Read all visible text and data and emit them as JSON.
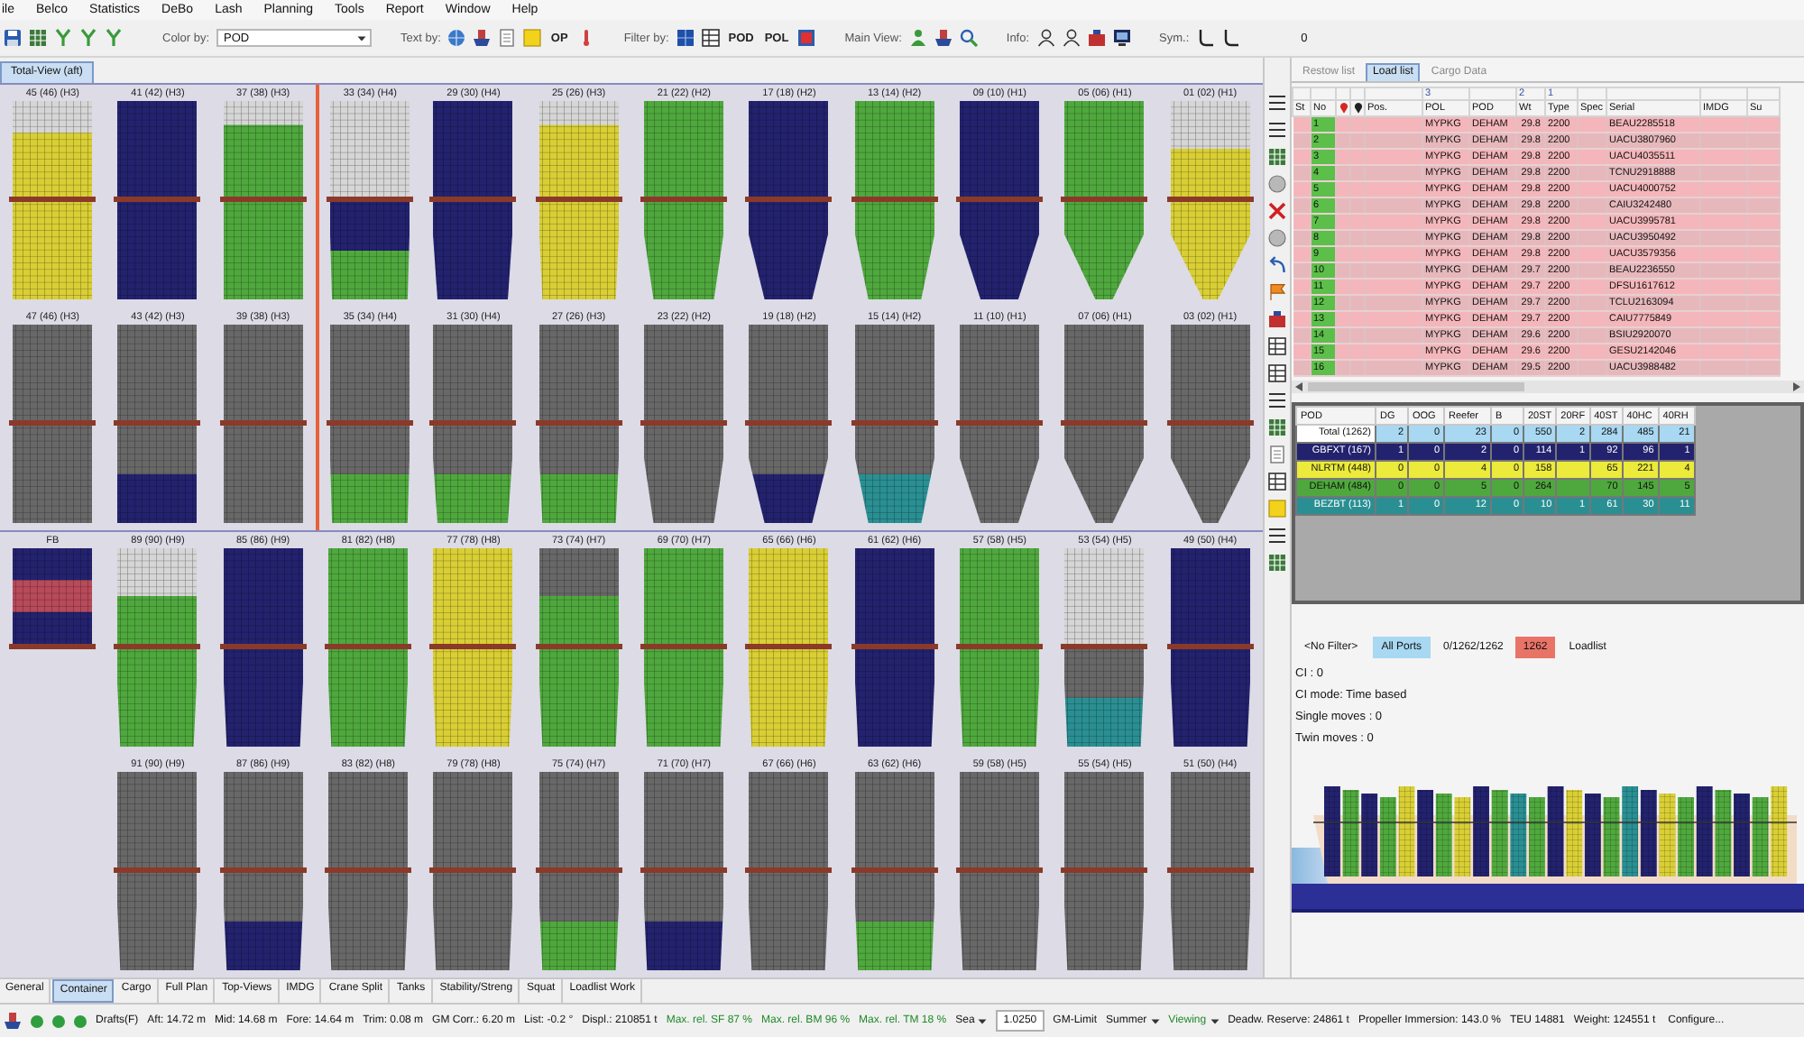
{
  "menu": [
    "ile",
    "Belco",
    "Statistics",
    "DeBo",
    "Lash",
    "Planning",
    "Tools",
    "Report",
    "Window",
    "Help"
  ],
  "toolbar": {
    "color_by": {
      "label": "Color by:",
      "value": "POD"
    },
    "text_by": {
      "label": "Text by:",
      "option": "OP"
    },
    "filter_by": {
      "label": "Filter by:",
      "options": [
        "POD",
        "POL"
      ]
    },
    "main_view": {
      "label": "Main View:"
    },
    "info": {
      "label": "Info:"
    },
    "sym": {
      "label": "Sym.:",
      "value": "0"
    }
  },
  "view_tab": {
    "label": "Total-View (aft)"
  },
  "bay_rows": [
    {
      "bays": [
        {
          "label": "45 (46) (H3)",
          "deck": [
            {
              "color": "#d6d6d6"
            },
            {
              "color": "#d9cf35"
            },
            {
              "color": "#d9cf35"
            }
          ],
          "hold": [
            {
              "color": "#d9cf35"
            }
          ]
        },
        {
          "label": "41 (42) (H3)",
          "deck": [
            {
              "color": "#23226e"
            }
          ],
          "hold": [
            {
              "color": "#23226e"
            }
          ]
        },
        {
          "label": "37 (38) (H3)",
          "deck": [
            {
              "color": "#d6d6d6"
            },
            {
              "color": "#4fa83d"
            },
            {
              "color": "#4fa83d"
            },
            {
              "color": "#4fa83d"
            }
          ],
          "hold": [
            {
              "color": "#4fa83d"
            }
          ]
        },
        {
          "label": "33 (34) (H4)",
          "deck": [
            {
              "color": "#d6d6d6"
            }
          ],
          "hold": [
            {
              "color": "#23226e"
            },
            {
              "color": "#4fa83d"
            }
          ]
        },
        {
          "label": "29 (30) (H4)",
          "deck": [
            {
              "color": "#23226e"
            }
          ],
          "hold": [
            {
              "color": "#23226e"
            }
          ]
        },
        {
          "label": "25 (26) (H3)",
          "deck": [
            {
              "color": "#d6d6d6"
            },
            {
              "color": "#d9cf35"
            },
            {
              "color": "#d9cf35"
            },
            {
              "color": "#d9cf35"
            }
          ],
          "hold": [
            {
              "color": "#d9cf35"
            }
          ]
        },
        {
          "label": "21 (22) (H2)",
          "deck": [
            {
              "color": "#4fa83d"
            }
          ],
          "hold": [
            {
              "color": "#4fa83d"
            }
          ]
        },
        {
          "label": "17 (18) (H2)",
          "deck": [
            {
              "color": "#23226e"
            }
          ],
          "hold": [
            {
              "color": "#23226e"
            }
          ]
        },
        {
          "label": "13 (14) (H2)",
          "deck": [
            {
              "color": "#4fa83d"
            }
          ],
          "hold": [
            {
              "color": "#4fa83d"
            }
          ]
        },
        {
          "label": "09 (10) (H1)",
          "deck": [
            {
              "color": "#23226e"
            }
          ],
          "hold": [
            {
              "color": "#23226e"
            }
          ]
        },
        {
          "label": "05 (06) (H1)",
          "deck": [
            {
              "color": "#4fa83d"
            }
          ],
          "hold": [
            {
              "color": "#4fa83d"
            }
          ]
        },
        {
          "label": "01 (02) (H1)",
          "deck": [
            {
              "color": "#d6d6d6"
            },
            {
              "color": "#d9cf35"
            }
          ],
          "hold": [
            {
              "color": "#d9cf35"
            }
          ]
        }
      ]
    },
    {
      "bays": [
        {
          "label": "47 (46) (H3)",
          "deck": [
            {
              "color": "#686868"
            }
          ],
          "hold": [
            {
              "color": "#686868"
            },
            {
              "color": "#686868"
            }
          ]
        },
        {
          "label": "43 (42) (H3)",
          "deck": [
            {
              "color": "#686868"
            }
          ],
          "hold": [
            {
              "color": "#686868"
            },
            {
              "color": "#23226e"
            }
          ]
        },
        {
          "label": "39 (38) (H3)",
          "deck": [
            {
              "color": "#686868"
            }
          ],
          "hold": [
            {
              "color": "#686868"
            },
            {
              "color": "#686868"
            }
          ]
        },
        {
          "label": "35 (34) (H4)",
          "deck": [
            {
              "color": "#686868"
            }
          ],
          "hold": [
            {
              "color": "#686868"
            },
            {
              "color": "#4fa83d"
            }
          ]
        },
        {
          "label": "31 (30) (H4)",
          "deck": [
            {
              "color": "#686868"
            }
          ],
          "hold": [
            {
              "color": "#686868"
            },
            {
              "color": "#4fa83d"
            }
          ]
        },
        {
          "label": "27 (26) (H3)",
          "deck": [
            {
              "color": "#686868"
            }
          ],
          "hold": [
            {
              "color": "#686868"
            },
            {
              "color": "#4fa83d"
            }
          ]
        },
        {
          "label": "23 (22) (H2)",
          "deck": [
            {
              "color": "#686868"
            }
          ],
          "hold": [
            {
              "color": "#686868"
            },
            {
              "color": "#686868"
            }
          ]
        },
        {
          "label": "19 (18) (H2)",
          "deck": [
            {
              "color": "#686868"
            }
          ],
          "hold": [
            {
              "color": "#686868"
            },
            {
              "color": "#23226e"
            }
          ]
        },
        {
          "label": "15 (14) (H2)",
          "deck": [
            {
              "color": "#686868"
            }
          ],
          "hold": [
            {
              "color": "#686868"
            },
            {
              "color": "#2a8f92"
            }
          ]
        },
        {
          "label": "11 (10) (H1)",
          "deck": [
            {
              "color": "#686868"
            }
          ],
          "hold": [
            {
              "color": "#686868"
            }
          ]
        },
        {
          "label": "07 (06) (H1)",
          "deck": [
            {
              "color": "#686868"
            }
          ],
          "hold": [
            {
              "color": "#686868"
            }
          ]
        },
        {
          "label": "03 (02) (H1)",
          "deck": [
            {
              "color": "#686868"
            }
          ],
          "hold": [
            {
              "color": "#686868"
            }
          ]
        }
      ]
    },
    {
      "bays": [
        {
          "label": "FB",
          "deck": [
            {
              "color": "#23226e"
            },
            {
              "color": "#b84a5a"
            },
            {
              "color": "#23226e"
            }
          ]
        },
        {
          "label": "89 (90) (H9)",
          "deck": [
            {
              "color": "#d6d6d6"
            },
            {
              "color": "#4fa83d"
            }
          ],
          "hold": [
            {
              "color": "#4fa83d"
            }
          ]
        },
        {
          "label": "85 (86) (H9)",
          "deck": [
            {
              "color": "#23226e"
            }
          ],
          "hold": [
            {
              "color": "#23226e"
            }
          ]
        },
        {
          "label": "81 (82) (H8)",
          "deck": [
            {
              "color": "#4fa83d"
            }
          ],
          "hold": [
            {
              "color": "#4fa83d"
            }
          ]
        },
        {
          "label": "77 (78) (H8)",
          "deck": [
            {
              "color": "#d9cf35"
            }
          ],
          "hold": [
            {
              "color": "#d9cf35"
            }
          ]
        },
        {
          "label": "73 (74) (H7)",
          "deck": [
            {
              "color": "#686868"
            },
            {
              "color": "#4fa83d"
            }
          ],
          "hold": [
            {
              "color": "#4fa83d"
            }
          ]
        },
        {
          "label": "69 (70) (H7)",
          "deck": [
            {
              "color": "#4fa83d"
            }
          ],
          "hold": [
            {
              "color": "#4fa83d"
            }
          ]
        },
        {
          "label": "65 (66) (H6)",
          "deck": [
            {
              "color": "#d9cf35"
            }
          ],
          "hold": [
            {
              "color": "#d9cf35"
            }
          ]
        },
        {
          "label": "61 (62) (H6)",
          "deck": [
            {
              "color": "#23226e"
            }
          ],
          "hold": [
            {
              "color": "#23226e"
            }
          ]
        },
        {
          "label": "57 (58) (H5)",
          "deck": [
            {
              "color": "#4fa83d"
            }
          ],
          "hold": [
            {
              "color": "#4fa83d"
            }
          ]
        },
        {
          "label": "53 (54) (H5)",
          "deck": [
            {
              "color": "#d6d6d6"
            }
          ],
          "hold": [
            {
              "color": "#686868"
            },
            {
              "color": "#2a8f92"
            }
          ]
        },
        {
          "label": "49 (50) (H4)",
          "deck": [
            {
              "color": "#23226e"
            }
          ],
          "hold": [
            {
              "color": "#23226e"
            }
          ]
        }
      ]
    },
    {
      "bays": [
        {
          "label": "91 (90) (H9)",
          "deck": [
            {
              "color": "#686868"
            }
          ],
          "hold": [
            {
              "color": "#686868"
            },
            {
              "color": "#686868"
            }
          ]
        },
        {
          "label": "87 (86) (H9)",
          "deck": [
            {
              "color": "#686868"
            }
          ],
          "hold": [
            {
              "color": "#686868"
            },
            {
              "color": "#23226e"
            }
          ]
        },
        {
          "label": "83 (82) (H8)",
          "deck": [
            {
              "color": "#686868"
            }
          ],
          "hold": [
            {
              "color": "#686868"
            },
            {
              "color": "#686868"
            }
          ]
        },
        {
          "label": "79 (78) (H8)",
          "deck": [
            {
              "color": "#686868"
            }
          ],
          "hold": [
            {
              "color": "#686868"
            },
            {
              "color": "#686868"
            }
          ]
        },
        {
          "label": "75 (74) (H7)",
          "deck": [
            {
              "color": "#686868"
            }
          ],
          "hold": [
            {
              "color": "#686868"
            },
            {
              "color": "#4fa83d"
            }
          ]
        },
        {
          "label": "71 (70) (H7)",
          "deck": [
            {
              "color": "#686868"
            }
          ],
          "hold": [
            {
              "color": "#686868"
            },
            {
              "color": "#23226e"
            }
          ]
        },
        {
          "label": "67 (66) (H6)",
          "deck": [
            {
              "color": "#686868"
            }
          ],
          "hold": [
            {
              "color": "#686868"
            },
            {
              "color": "#686868"
            }
          ]
        },
        {
          "label": "63 (62) (H6)",
          "deck": [
            {
              "color": "#686868"
            }
          ],
          "hold": [
            {
              "color": "#686868"
            },
            {
              "color": "#4fa83d"
            }
          ]
        },
        {
          "label": "59 (58) (H5)",
          "deck": [
            {
              "color": "#686868"
            }
          ],
          "hold": [
            {
              "color": "#686868"
            },
            {
              "color": "#686868"
            }
          ]
        },
        {
          "label": "55 (54) (H5)",
          "deck": [
            {
              "color": "#686868"
            }
          ],
          "hold": [
            {
              "color": "#686868"
            },
            {
              "color": "#686868"
            }
          ]
        },
        {
          "label": "51 (50) (H4)",
          "deck": [
            {
              "color": "#686868"
            }
          ],
          "hold": [
            {
              "color": "#686868"
            },
            {
              "color": "#686868"
            }
          ]
        }
      ]
    }
  ],
  "side_panel": {
    "tabs": [
      {
        "label": "Restow list",
        "selected": false
      },
      {
        "label": "Load list",
        "selected": true
      },
      {
        "label": "Cargo Data",
        "selected": false
      }
    ],
    "load_list": {
      "columns": [
        {
          "kind": "text",
          "label": "St"
        },
        {
          "kind": "text",
          "label": "No"
        },
        {
          "kind": "icon",
          "color": "#d02828"
        },
        {
          "kind": "icon",
          "color": "#222222"
        },
        {
          "kind": "text",
          "label": "Pos."
        },
        {
          "kind": "text",
          "label": "POL",
          "sort": "3"
        },
        {
          "kind": "text",
          "label": "POD"
        },
        {
          "kind": "text",
          "label": "Wt",
          "sort": "2"
        },
        {
          "kind": "text",
          "label": "Type",
          "sort": "1"
        },
        {
          "kind": "text",
          "label": "Spec"
        },
        {
          "kind": "text",
          "label": "Serial"
        },
        {
          "kind": "text",
          "label": "IMDG"
        },
        {
          "kind": "text",
          "label": "Su"
        }
      ],
      "rows": [
        {
          "no": "1",
          "pol": "MYPKG",
          "pod": "DEHAM",
          "wt": "29.8",
          "type": "2200",
          "serial": "BEAU2285518"
        },
        {
          "no": "2",
          "pol": "MYPKG",
          "pod": "DEHAM",
          "wt": "29.8",
          "type": "2200",
          "serial": "UACU3807960"
        },
        {
          "no": "3",
          "pol": "MYPKG",
          "pod": "DEHAM",
          "wt": "29.8",
          "type": "2200",
          "serial": "UACU4035511"
        },
        {
          "no": "4",
          "pol": "MYPKG",
          "pod": "DEHAM",
          "wt": "29.8",
          "type": "2200",
          "serial": "TCNU2918888"
        },
        {
          "no": "5",
          "pol": "MYPKG",
          "pod": "DEHAM",
          "wt": "29.8",
          "type": "2200",
          "serial": "UACU4000752"
        },
        {
          "no": "6",
          "pol": "MYPKG",
          "pod": "DEHAM",
          "wt": "29.8",
          "type": "2200",
          "serial": "CAIU3242480"
        },
        {
          "no": "7",
          "pol": "MYPKG",
          "pod": "DEHAM",
          "wt": "29.8",
          "type": "2200",
          "serial": "UACU3995781"
        },
        {
          "no": "8",
          "pol": "MYPKG",
          "pod": "DEHAM",
          "wt": "29.8",
          "type": "2200",
          "serial": "UACU3950492"
        },
        {
          "no": "9",
          "pol": "MYPKG",
          "pod": "DEHAM",
          "wt": "29.8",
          "type": "2200",
          "serial": "UACU3579356"
        },
        {
          "no": "10",
          "pol": "MYPKG",
          "pod": "DEHAM",
          "wt": "29.7",
          "type": "2200",
          "serial": "BEAU2236550"
        },
        {
          "no": "11",
          "pol": "MYPKG",
          "pod": "DEHAM",
          "wt": "29.7",
          "type": "2200",
          "serial": "DFSU1617612"
        },
        {
          "no": "12",
          "pol": "MYPKG",
          "pod": "DEHAM",
          "wt": "29.7",
          "type": "2200",
          "serial": "TCLU2163094"
        },
        {
          "no": "13",
          "pol": "MYPKG",
          "pod": "DEHAM",
          "wt": "29.7",
          "type": "2200",
          "serial": "CAIU7775849"
        },
        {
          "no": "14",
          "pol": "MYPKG",
          "pod": "DEHAM",
          "wt": "29.6",
          "type": "2200",
          "serial": "BSIU2920070"
        },
        {
          "no": "15",
          "pol": "MYPKG",
          "pod": "DEHAM",
          "wt": "29.6",
          "type": "2200",
          "serial": "GESU2142046"
        },
        {
          "no": "16",
          "pol": "MYPKG",
          "pod": "DEHAM",
          "wt": "29.5",
          "type": "2200",
          "serial": "UACU3988482"
        }
      ]
    },
    "summary": {
      "columns": [
        "POD",
        "DG",
        "OOG",
        "Reefer",
        "B",
        "20ST",
        "20RF",
        "40ST",
        "40HC",
        "40RH"
      ],
      "rows": [
        {
          "kind": "total",
          "color": "#a8d8f2",
          "label": "Total (1262)",
          "values": {
            "dg": "2",
            "oog": "0",
            "reefer": "23",
            "b": "0",
            "st20": "550",
            "rf20": "2",
            "st40": "284",
            "hc40": "485",
            "rh40": "21"
          }
        },
        {
          "kind": "port",
          "color": "#23226e",
          "label": "GBFXT (167)",
          "values": {
            "dg": "1",
            "oog": "0",
            "reefer": "2",
            "b": "0",
            "st20": "114",
            "rf20": "1",
            "st40": "92",
            "hc40": "96",
            "rh40": "1"
          }
        },
        {
          "kind": "port",
          "color": "#ecea3a",
          "label": "NLRTM (448)",
          "values": {
            "dg": "0",
            "oog": "0",
            "reefer": "4",
            "b": "0",
            "st20": "158",
            "st40": "65",
            "hc40": "221",
            "rh40": "4"
          }
        },
        {
          "kind": "port",
          "color": "#4fa83d",
          "label": "DEHAM (484)",
          "values": {
            "dg": "0",
            "oog": "0",
            "reefer": "5",
            "b": "0",
            "st20": "264",
            "st40": "70",
            "hc40": "145",
            "rh40": "5"
          }
        },
        {
          "kind": "port",
          "color": "#2a8f92",
          "label": "BEZBT (113)",
          "values": {
            "dg": "1",
            "oog": "0",
            "reefer": "12",
            "b": "0",
            "st20": "10",
            "rf20": "1",
            "st40": "61",
            "hc40": "30",
            "rh40": "11"
          }
        }
      ]
    },
    "filters": [
      {
        "kind": "button",
        "text": "<No Filter>",
        "color": "#f4f4f4"
      },
      {
        "kind": "button",
        "text": "All Ports",
        "color": "#a8d8f2"
      },
      {
        "kind": "counter",
        "text": "0/1262/1262",
        "color": "#f4f4f4"
      },
      {
        "kind": "counter",
        "text": "1262",
        "color": "#e87468"
      },
      {
        "kind": "button",
        "text": "Loadlist",
        "color": "#f4f4f4"
      }
    ],
    "info_lines": [
      "CI : 0",
      "CI mode: Time based",
      "Single moves : 0",
      "Twin moves : 0"
    ],
    "ship_profile": {
      "stacks": [
        {
          "color": "#23226e"
        },
        {
          "color": "#4fa83d"
        },
        {
          "color": "#23226e"
        },
        {
          "color": "#4fa83d"
        },
        {
          "color": "#d9cf35"
        },
        {
          "color": "#23226e"
        },
        {
          "color": "#4fa83d"
        },
        {
          "color": "#d9cf35"
        },
        {
          "color": "#23226e"
        },
        {
          "color": "#4fa83d"
        },
        {
          "color": "#2a8f92"
        },
        {
          "color": "#4fa83d"
        },
        {
          "color": "#23226e"
        },
        {
          "color": "#d9cf35"
        },
        {
          "color": "#23226e"
        },
        {
          "color": "#4fa83d"
        },
        {
          "color": "#2a8f92"
        },
        {
          "color": "#23226e"
        },
        {
          "color": "#d9cf35"
        },
        {
          "color": "#4fa83d"
        },
        {
          "color": "#23226e"
        },
        {
          "color": "#4fa83d"
        },
        {
          "color": "#23226e"
        },
        {
          "color": "#4fa83d"
        },
        {
          "color": "#d9cf35"
        }
      ]
    }
  },
  "bottom_tabs": [
    {
      "label": "General",
      "selected": false
    },
    {
      "label": "Container",
      "selected": true
    },
    {
      "label": "Cargo",
      "selected": false
    },
    {
      "label": "Full Plan",
      "selected": false
    },
    {
      "label": "Top-Views",
      "selected": false
    },
    {
      "label": "IMDG",
      "selected": false
    },
    {
      "label": "Crane Split",
      "selected": false
    },
    {
      "label": "Tanks",
      "selected": false
    },
    {
      "label": "Stability/Streng",
      "selected": false
    },
    {
      "label": "Squat",
      "selected": false
    },
    {
      "label": "Loadlist Work",
      "selected": false
    }
  ],
  "status_bar": {
    "lights": [
      {
        "color": "#2e9e3e"
      },
      {
        "color": "#2e9e3e"
      },
      {
        "color": "#2e9e3e"
      }
    ],
    "items": [
      {
        "kind": "text",
        "text": "Drafts(F)",
        "good": false
      },
      {
        "kind": "text",
        "text": "Aft: 14.72 m",
        "good": false
      },
      {
        "kind": "text",
        "text": "Mid: 14.68 m",
        "good": false
      },
      {
        "kind": "text",
        "text": "Fore: 14.64 m",
        "good": false
      },
      {
        "kind": "text",
        "text": "Trim: 0.08 m",
        "good": false
      },
      {
        "kind": "text",
        "text": "GM Corr.: 6.20 m",
        "good": false
      },
      {
        "kind": "text",
        "text": "List: -0.2 °",
        "good": false
      },
      {
        "kind": "text",
        "text": "Displ.: 210851 t",
        "good": false
      },
      {
        "kind": "text",
        "text": "Max. rel. SF 87 %",
        "good": true
      },
      {
        "kind": "text",
        "text": "Max. rel. BM 96 %",
        "good": true
      },
      {
        "kind": "text",
        "text": "Max. rel. TM 18 %",
        "good": true
      },
      {
        "kind": "menu",
        "text": "Sea",
        "good": false
      },
      {
        "kind": "input",
        "text": "1.0250",
        "good": false
      },
      {
        "kind": "text",
        "text": "GM-Limit",
        "good": false
      },
      {
        "kind": "menu",
        "text": "Summer",
        "good": false
      },
      {
        "kind": "menu",
        "text": "Viewing",
        "good": true
      },
      {
        "kind": "text",
        "text": "Deadw. Reserve: 24861 t",
        "good": false
      },
      {
        "kind": "text",
        "text": "Propeller Immersion: 143.0 %",
        "good": false
      },
      {
        "kind": "text",
        "text": "TEU 14881",
        "good": false
      },
      {
        "kind": "text",
        "text": "Weight: 124551 t",
        "good": false
      },
      {
        "kind": "button",
        "text": "Configure...",
        "good": false
      }
    ]
  }
}
